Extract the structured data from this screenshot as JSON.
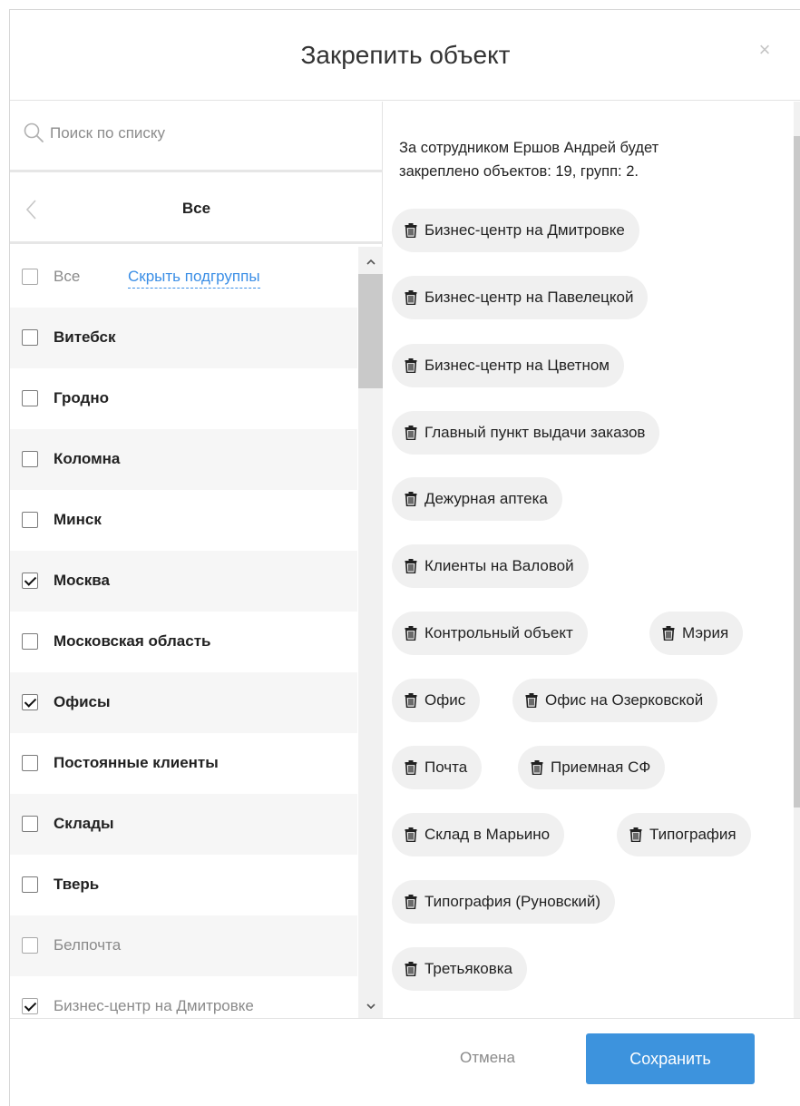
{
  "dialog": {
    "title": "Закрепить объект",
    "close_glyph": "×"
  },
  "search": {
    "placeholder": "Поиск по списку",
    "value": ""
  },
  "nav": {
    "title": "Все"
  },
  "list": {
    "all_label": "Все",
    "hide_subgroups": "Скрыть подгруппы",
    "items": [
      {
        "label": "Витебск",
        "checked": false,
        "muted": false
      },
      {
        "label": "Гродно",
        "checked": false,
        "muted": false
      },
      {
        "label": "Коломна",
        "checked": false,
        "muted": false
      },
      {
        "label": "Минск",
        "checked": false,
        "muted": false
      },
      {
        "label": "Москва",
        "checked": true,
        "muted": false
      },
      {
        "label": "Московская область",
        "checked": false,
        "muted": false
      },
      {
        "label": "Офисы",
        "checked": true,
        "muted": false
      },
      {
        "label": "Постоянные клиенты",
        "checked": false,
        "muted": false
      },
      {
        "label": "Склады",
        "checked": false,
        "muted": false
      },
      {
        "label": "Тверь",
        "checked": false,
        "muted": false
      },
      {
        "label": "Белпочта",
        "checked": false,
        "muted": true
      },
      {
        "label": "Бизнес-центр на Дмитровке",
        "checked": true,
        "muted": true
      }
    ]
  },
  "summary": {
    "line1": "За сотрудником Ершов Андрей будет",
    "line2": "закреплено объектов: 19, групп: 2."
  },
  "chips": [
    "Бизнес-центр на Дмитровке",
    "Бизнес-центр на Павелецкой",
    "Бизнес-центр на Цветном",
    "Главный пункт выдачи заказов",
    "Дежурная аптека",
    "Клиенты на Валовой",
    "Контрольный объект",
    "Мэрия",
    "Офис",
    "Офис на Озерковской",
    "Почта",
    "Приемная СФ",
    "Склад в Марьино",
    "Типография",
    "Типография (Руновский)",
    "Третьяковка"
  ],
  "footer": {
    "cancel": "Отмена",
    "save": "Сохранить"
  },
  "colors": {
    "accent": "#3d93dd",
    "link": "#3a8ee6",
    "chip_bg": "#f0f0f0"
  }
}
